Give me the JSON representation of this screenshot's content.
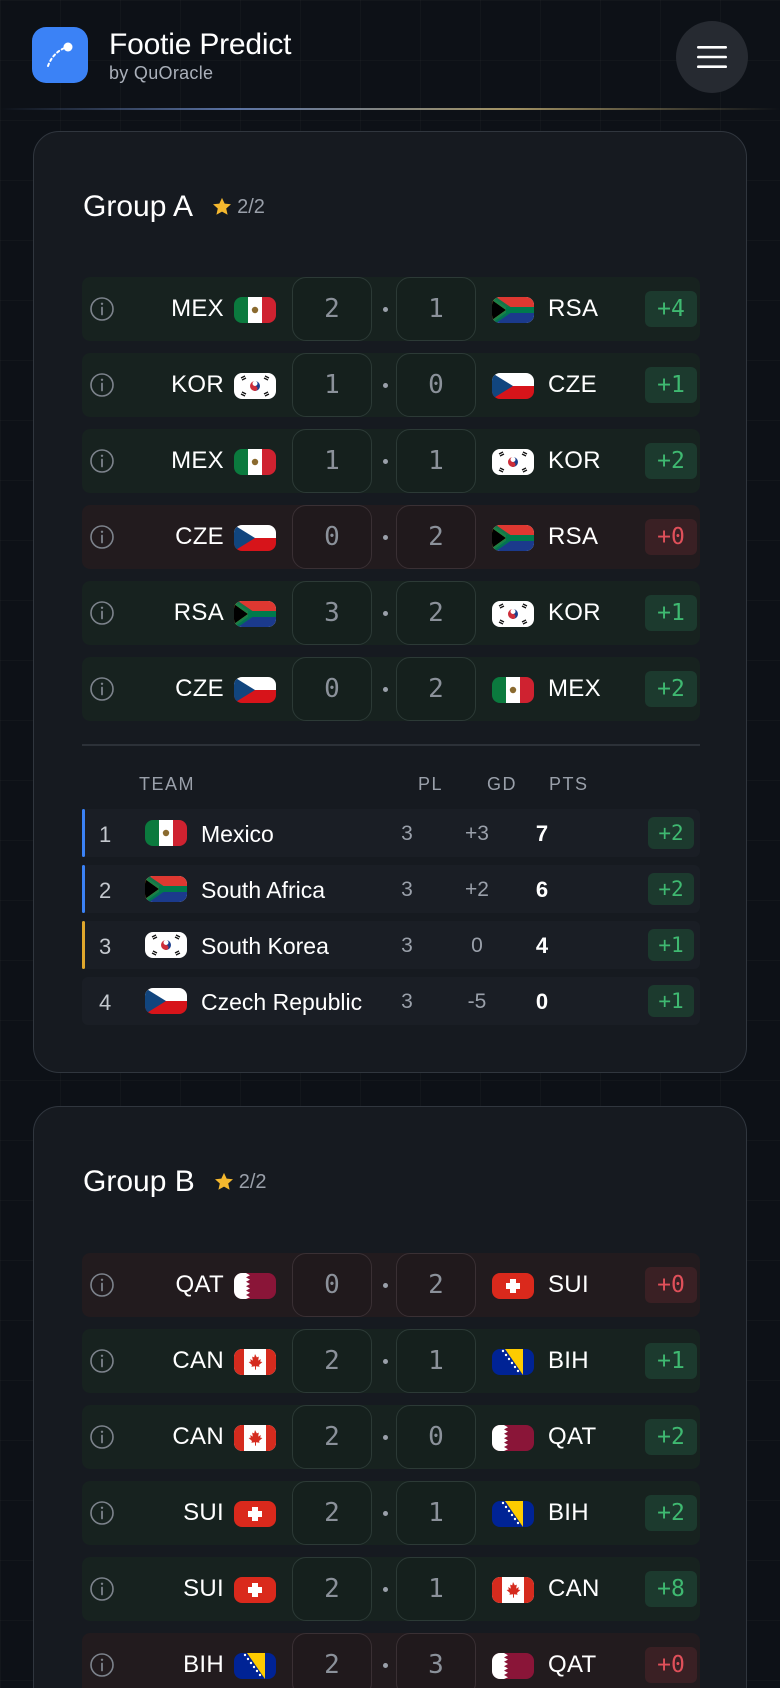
{
  "app": {
    "title": "Footie Predict",
    "subtitle": "by QuOracle",
    "logo_icon": "chart-arc-icon",
    "menu_icon": "hamburger-menu-icon"
  },
  "colors": {
    "accent": "#3b82f6",
    "win_badge_text": "#3fb971",
    "loss_badge_text": "#e0505a",
    "star": "#f5b82e",
    "qualified_bar": "#3b82f6",
    "playoff_bar": "#e0a72c"
  },
  "standings_headers": {
    "team": "TEAM",
    "pl": "PL",
    "gd": "GD",
    "pts": "PTS"
  },
  "groups": [
    {
      "title": "Group A",
      "stars": "2/2",
      "matches": [
        {
          "home": "MEX",
          "home_flag": "mex",
          "home_score": "2",
          "away_score": "1",
          "away": "RSA",
          "away_flag": "rsa",
          "points": "+4",
          "result": "win"
        },
        {
          "home": "KOR",
          "home_flag": "kor",
          "home_score": "1",
          "away_score": "0",
          "away": "CZE",
          "away_flag": "cze",
          "points": "+1",
          "result": "win"
        },
        {
          "home": "MEX",
          "home_flag": "mex",
          "home_score": "1",
          "away_score": "1",
          "away": "KOR",
          "away_flag": "kor",
          "points": "+2",
          "result": "win"
        },
        {
          "home": "CZE",
          "home_flag": "cze",
          "home_score": "0",
          "away_score": "2",
          "away": "RSA",
          "away_flag": "rsa",
          "points": "+0",
          "result": "loss"
        },
        {
          "home": "RSA",
          "home_flag": "rsa",
          "home_score": "3",
          "away_score": "2",
          "away": "KOR",
          "away_flag": "kor",
          "points": "+1",
          "result": "win"
        },
        {
          "home": "CZE",
          "home_flag": "cze",
          "home_score": "0",
          "away_score": "2",
          "away": "MEX",
          "away_flag": "mex",
          "points": "+2",
          "result": "win"
        }
      ],
      "standings": [
        {
          "pos": "1",
          "flag": "mex",
          "name": "Mexico",
          "pl": "3",
          "gd": "+3",
          "pts": "7",
          "bonus": "+2",
          "status": "qualified"
        },
        {
          "pos": "2",
          "flag": "rsa",
          "name": "South Africa",
          "pl": "3",
          "gd": "+2",
          "pts": "6",
          "bonus": "+2",
          "status": "qualified"
        },
        {
          "pos": "3",
          "flag": "kor",
          "name": "South Korea",
          "pl": "3",
          "gd": "0",
          "pts": "4",
          "bonus": "+1",
          "status": "playoff"
        },
        {
          "pos": "4",
          "flag": "cze",
          "name": "Czech Republic",
          "pl": "3",
          "gd": "-5",
          "pts": "0",
          "bonus": "+1",
          "status": "none"
        }
      ]
    },
    {
      "title": "Group B",
      "stars": "2/2",
      "matches": [
        {
          "home": "QAT",
          "home_flag": "qat",
          "home_score": "0",
          "away_score": "2",
          "away": "SUI",
          "away_flag": "sui",
          "points": "+0",
          "result": "loss"
        },
        {
          "home": "CAN",
          "home_flag": "can",
          "home_score": "2",
          "away_score": "1",
          "away": "BIH",
          "away_flag": "bih",
          "points": "+1",
          "result": "win"
        },
        {
          "home": "CAN",
          "home_flag": "can",
          "home_score": "2",
          "away_score": "0",
          "away": "QAT",
          "away_flag": "qat",
          "points": "+2",
          "result": "win"
        },
        {
          "home": "SUI",
          "home_flag": "sui",
          "home_score": "2",
          "away_score": "1",
          "away": "BIH",
          "away_flag": "bih",
          "points": "+2",
          "result": "win"
        },
        {
          "home": "SUI",
          "home_flag": "sui",
          "home_score": "2",
          "away_score": "1",
          "away": "CAN",
          "away_flag": "can",
          "points": "+8",
          "result": "win"
        },
        {
          "home": "BIH",
          "home_flag": "bih",
          "home_score": "2",
          "away_score": "3",
          "away": "QAT",
          "away_flag": "qat",
          "points": "+0",
          "result": "loss"
        }
      ]
    }
  ]
}
